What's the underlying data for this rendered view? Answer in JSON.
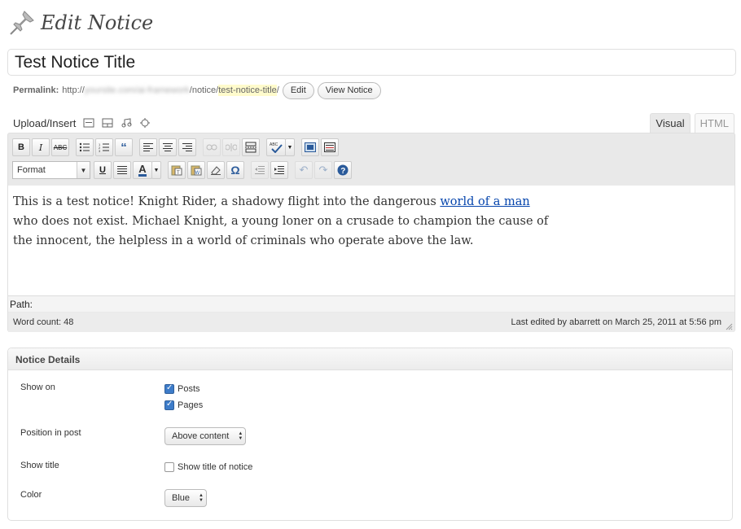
{
  "page": {
    "title": "Edit Notice"
  },
  "title_input": {
    "value": "Test Notice Title"
  },
  "permalink": {
    "label": "Permalink:",
    "prefix": "http://",
    "domain_blurred": "yoursite.com/ai-framework",
    "path": "/notice/",
    "slug": "test-notice-title",
    "suffix": "/",
    "edit_label": "Edit",
    "view_label": "View Notice"
  },
  "media": {
    "label": "Upload/Insert",
    "icons": [
      "image-icon",
      "video-icon",
      "audio-icon",
      "media-icon"
    ]
  },
  "editor": {
    "tabs": [
      {
        "label": "Visual",
        "active": true
      },
      {
        "label": "HTML",
        "active": false
      }
    ],
    "format_label": "Format",
    "content": {
      "line1_text": "This is a test notice! Knight Rider, a shadowy flight into the dangerous ",
      "link_text": "world of a man",
      "line2": "who does not exist. Michael Knight, a young loner on a crusade to champion the cause of",
      "line3": "the innocent, the helpless in a world of criminals who operate above the law."
    },
    "path_label": "Path:",
    "word_count": "Word count: 48",
    "last_edited": "Last edited by abarrett on March 25, 2011 at 5:56 pm"
  },
  "metabox": {
    "title": "Notice Details",
    "show_on": {
      "label": "Show on",
      "options": [
        {
          "label": "Posts",
          "checked": true
        },
        {
          "label": "Pages",
          "checked": true
        }
      ]
    },
    "position": {
      "label": "Position in post",
      "value": "Above content"
    },
    "show_title": {
      "label": "Show title",
      "option": "Show title of notice",
      "checked": false
    },
    "color": {
      "label": "Color",
      "value": "Blue"
    }
  }
}
